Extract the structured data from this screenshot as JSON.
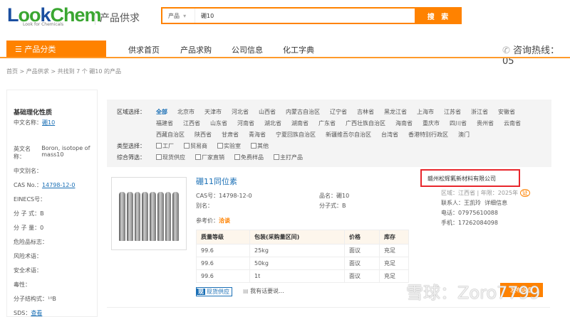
{
  "header": {
    "logo_text": "LookChem",
    "logo_sub": "Look for Chemicals",
    "section": "产品供求",
    "search_category": "产品",
    "search_value": "硼10",
    "search_button": "搜 索"
  },
  "nav": {
    "category": "产品分类",
    "items": [
      "供求首页",
      "产品求购",
      "公司信息",
      "化工字典"
    ],
    "phone": "咨询热线：05"
  },
  "breadcrumb": "首页 > 产品供求 > 共找到 7 个 硼10 的产品",
  "left": {
    "title": "基础理化性质",
    "fields": [
      {
        "label": "中文名称：",
        "value": "硼10",
        "link": true
      },
      {
        "label": "英文名称：",
        "value": "Boron, isotope of mass10"
      },
      {
        "label": "中文别名：",
        "value": ""
      },
      {
        "label": "CAS No.：",
        "value": "14798-12-0",
        "link": true
      },
      {
        "label": "EINECS号：",
        "value": ""
      },
      {
        "label": "分 子 式：",
        "value": "B"
      },
      {
        "label": "分 子 量：",
        "value": "0"
      },
      {
        "label": "危险品标志：",
        "value": ""
      },
      {
        "label": "风险术语：",
        "value": ""
      },
      {
        "label": "安全术语：",
        "value": ""
      },
      {
        "label": "毒性：",
        "value": ""
      },
      {
        "label": "分子结构式：",
        "value": "¹⁰B"
      },
      {
        "label": "SDS：",
        "value": "查看",
        "link": true
      }
    ]
  },
  "filter": {
    "region_label": "区域选择：",
    "regions": [
      "全部",
      "北京市",
      "天津市",
      "河北省",
      "山西省",
      "内蒙古自治区",
      "辽宁省",
      "吉林省",
      "黑龙江省",
      "上海市",
      "江苏省",
      "浙江省",
      "安徽省",
      "福建省",
      "江西省",
      "山东省",
      "河南省",
      "湖北省",
      "湖南省",
      "广东省",
      "广西壮族自治区",
      "海南省",
      "重庆市",
      "四川省",
      "贵州省",
      "云南省",
      "西藏自治区",
      "陕西省",
      "甘肃省",
      "青海省",
      "宁夏回族自治区",
      "新疆维吾尔自治区",
      "台湾省",
      "香港特别行政区",
      "澳门"
    ],
    "type_label": "类型选择：",
    "types": [
      "工厂",
      "贸易商",
      "实验室",
      "其他"
    ],
    "combo_label": "综合筛选：",
    "combos": [
      "现货供应",
      "厂家直销",
      "免费样品",
      "主打产品"
    ]
  },
  "product": {
    "title": "硼11同位素",
    "cas": "CAS号：14798-12-0",
    "name": "品名：硼10",
    "alias": "别名：",
    "formula": "分子式：B",
    "price_label": "参考价：",
    "price": "洽谈",
    "table": {
      "headers": [
        "质量等级",
        "包装(采购量区间)",
        "价格",
        "库存"
      ],
      "rows": [
        [
          "99.6",
          "25kg",
          "面议",
          "充足"
        ],
        [
          "99.6",
          "50kg",
          "面议",
          "充足"
        ],
        [
          "99.6",
          "1t",
          "面议",
          "充足"
        ]
      ]
    },
    "tag_icon": "现",
    "tag": "现货供应",
    "say": "我有话要说..."
  },
  "company": {
    "name": "赣州松辉氟新材料有限公司",
    "region": "区域：江西省 | 年限：2025年",
    "cert": "证",
    "contact": "联系人：王凯玲",
    "detail": "详细信息",
    "phone": "电话：07975610088",
    "mobile": "手机：17262084098",
    "button": "发布询盘"
  },
  "watermark": "雪球：Zoro7799",
  "colors": {
    "accent": "#ff8200",
    "link": "#1a6fb5",
    "highlight": "#e8262c"
  }
}
